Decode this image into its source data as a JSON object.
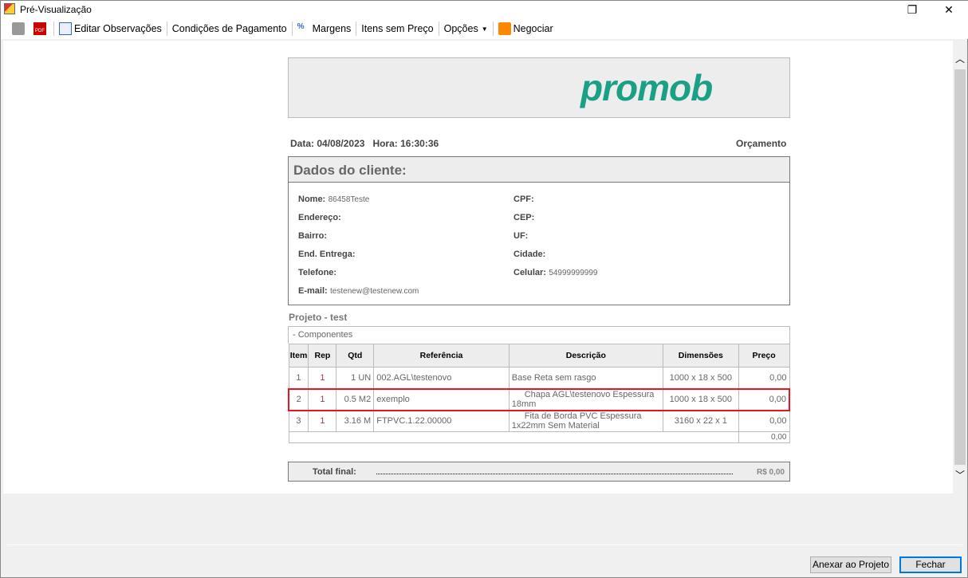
{
  "window": {
    "title": "Pré-Visualização",
    "restore_icon": "❐",
    "close_icon": "✕"
  },
  "toolbar": {
    "items": [
      "Editar Observações",
      "Condições de Pagamento",
      "Margens",
      "Itens sem Preço",
      "Opções",
      "Negociar"
    ]
  },
  "report": {
    "logo": "promob",
    "date_label": "Data:",
    "date": "04/08/2023",
    "time_label": "Hora:",
    "time": "16:30:36",
    "doc_type": "Orçamento",
    "client_title": "Dados do cliente:",
    "fields_left": [
      {
        "label": "Nome:",
        "value": "86458Teste"
      },
      {
        "label": "Endereço:",
        "value": ""
      },
      {
        "label": "Bairro:",
        "value": ""
      },
      {
        "label": "End. Entrega:",
        "value": ""
      },
      {
        "label": "Telefone:",
        "value": ""
      },
      {
        "label": "E-mail:",
        "value": "testenew@testenew.com"
      }
    ],
    "fields_right": [
      {
        "label": "CPF:",
        "value": ""
      },
      {
        "label": "CEP:",
        "value": ""
      },
      {
        "label": "UF:",
        "value": ""
      },
      {
        "label": "Cidade:",
        "value": ""
      },
      {
        "label": "Celular:",
        "value": "54999999999"
      }
    ],
    "project": "Projeto - test",
    "section": "- Componentes",
    "columns": [
      "Item",
      "Rep",
      "Qtd",
      "Referência",
      "Descrição",
      "Dimensões",
      "Preço"
    ],
    "rows": [
      [
        "1",
        "1",
        "1 UN",
        "002.AGL\\testenovo",
        "Base Reta sem rasgo",
        "1000 x 18 x 500",
        "0,00"
      ],
      [
        "2",
        "1",
        "0.5 M2",
        "exemplo",
        "Chapa AGL\\testenovo Espessura 18mm",
        "1000 x 18 x 500",
        "0,00"
      ],
      [
        "3",
        "1",
        "3.16 M",
        "FTPVC.1.22.00000",
        "Fita de Borda PVC Espessura 1x22mm Sem Material",
        "3160 x 22 x 1",
        "0,00"
      ]
    ],
    "subtotal": "0,00",
    "total_label": "Total final:",
    "total": "R$ 0,00"
  },
  "footer": {
    "attach": "Anexar ao Projeto",
    "close": "Fechar"
  },
  "colors": {
    "brand": "#1aa085",
    "highlight": "#e8141e"
  }
}
